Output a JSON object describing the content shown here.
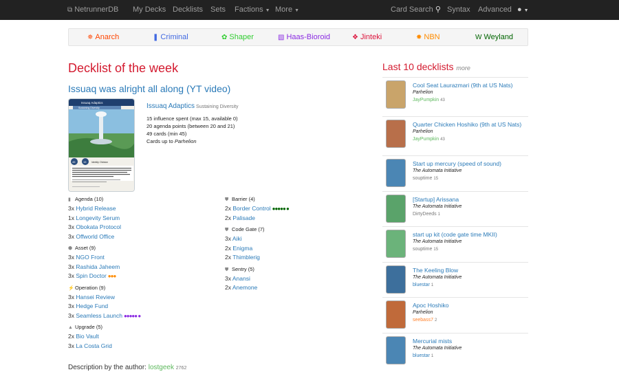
{
  "nav": {
    "brand": "NetrunnerDB",
    "links": [
      "My Decks",
      "Decklists",
      "Sets"
    ],
    "factions_label": "Factions",
    "more_label": "More",
    "card_search": "Card Search",
    "syntax": "Syntax",
    "advanced": "Advanced"
  },
  "factions": [
    {
      "label": "Anarch",
      "color": "#ff4500",
      "icon": "anarch-icon"
    },
    {
      "label": "Criminal",
      "color": "#4169e1",
      "icon": "criminal-icon"
    },
    {
      "label": "Shaper",
      "color": "#32cd32",
      "icon": "shaper-icon"
    },
    {
      "label": "Haas-Bioroid",
      "color": "#8a2be2",
      "icon": "haas-bioroid-icon"
    },
    {
      "label": "Jinteki",
      "color": "#dc143c",
      "icon": "jinteki-icon"
    },
    {
      "label": "NBN",
      "color": "#ff8c00",
      "icon": "nbn-icon"
    },
    {
      "label": "Weyland",
      "color": "#006400",
      "icon": "weyland-icon"
    }
  ],
  "main": {
    "heading": "Decklist of the week",
    "deck_name": "Issuaq was alright all along (YT video)",
    "identity": "Issuaq Adaptics",
    "identity_sub": "Sustaining Diversity",
    "stats": [
      "15 influence spent (max 15, available 0)",
      "20 agenda points (between 20 and 21)",
      "49 cards (min 45)"
    ],
    "cards_up_to_prefix": "Cards up to",
    "cards_up_to_set": "Parhelion",
    "card_image_text": {
      "title": "Issuaq Adaptics",
      "subtitle": "Sustaining Diversity",
      "stat_left": "45",
      "stat_right": "15",
      "type": "Identity: Division",
      "text": "Whenever you score an agenda that you did not install or advance this turn, place 1 power counter on this identity. You get 1 additional agenda point for each hosted power counter.",
      "flavor": "Bringing Mother Nature up to speed."
    }
  },
  "deck": {
    "left": [
      {
        "title": "Agenda (10)",
        "icon": "agenda-icon",
        "cards": [
          [
            "3x",
            "Hybrid Release",
            ""
          ],
          [
            "1x",
            "Longevity Serum",
            ""
          ],
          [
            "3x",
            "Obokata Protocol",
            ""
          ],
          [
            "3x",
            "Offworld Office",
            ""
          ]
        ]
      },
      {
        "title": "Asset (9)",
        "icon": "asset-icon",
        "cards": [
          [
            "3x",
            "NGO Front",
            ""
          ],
          [
            "3x",
            "Rashida Jaheem",
            ""
          ],
          [
            "3x",
            "Spin Doctor",
            "●●●"
          ]
        ]
      },
      {
        "title": "Operation (9)",
        "icon": "operation-icon",
        "cards": [
          [
            "3x",
            "Hansei Review",
            ""
          ],
          [
            "3x",
            "Hedge Fund",
            ""
          ],
          [
            "3x",
            "Seamless Launch",
            "●●●●● ●"
          ]
        ]
      },
      {
        "title": "Upgrade (5)",
        "icon": "upgrade-icon",
        "cards": [
          [
            "2x",
            "Bio Vault",
            ""
          ],
          [
            "3x",
            "La Costa Grid",
            ""
          ]
        ]
      }
    ],
    "right": [
      {
        "title": "Barrier (4)",
        "icon": "ice-icon",
        "cards": [
          [
            "2x",
            "Border Control",
            "●●●●● ●"
          ],
          [
            "2x",
            "Palisade",
            ""
          ]
        ]
      },
      {
        "title": "Code Gate (7)",
        "icon": "ice-icon",
        "cards": [
          [
            "3x",
            "Aiki",
            ""
          ],
          [
            "2x",
            "Enigma",
            ""
          ],
          [
            "2x",
            "Thimblerig",
            ""
          ]
        ]
      },
      {
        "title": "Sentry (5)",
        "icon": "ice-icon",
        "cards": [
          [
            "3x",
            "Anansi",
            ""
          ],
          [
            "2x",
            "Anemone",
            ""
          ]
        ]
      }
    ],
    "influence_colors": {
      "Spin Doctor": "#ff8c00",
      "Seamless Launch": "#8a2be2",
      "Border Control": "#006400"
    }
  },
  "description": {
    "prefix": "Description by the author:",
    "author": "lostgeek",
    "reputation": "2762"
  },
  "sidebar": {
    "heading": "Last 10 decklists",
    "more": "more",
    "items": [
      {
        "title": "Cool Seat Laurazmari (9th at US Nats)",
        "format": "Parhelion",
        "user": "JayPumpkin",
        "rep": "43",
        "user_color": "#5cb85c",
        "thumb": "#c9a46a"
      },
      {
        "title": "Quarter Chicken Hoshiko (9th at US Nats)",
        "format": "Parhelion",
        "user": "JayPumpkin",
        "rep": "43",
        "user_color": "#5cb85c",
        "thumb": "#b86f4a"
      },
      {
        "title": "Start up mercury (speed of sound)",
        "format": "The Automata Initiative",
        "user": "souptime",
        "rep": "15",
        "user_color": "#777777",
        "thumb": "#4b86b4"
      },
      {
        "title": "[Startup] Arissana",
        "format": "The Automata Initiative",
        "user": "DirtyDeeds",
        "rep": "1",
        "user_color": "#777777",
        "thumb": "#5aa36a"
      },
      {
        "title": "start up kit (code gate time MKII)",
        "format": "The Automata Initiative",
        "user": "souptime",
        "rep": "15",
        "user_color": "#777777",
        "thumb": "#6bb37a"
      },
      {
        "title": "The Keeling Blow",
        "format": "The Automata Initiative",
        "user": "bluestar",
        "rep": "1",
        "user_color": "#2a7ab8",
        "thumb": "#3d6f9c"
      },
      {
        "title": "Apoc Hoshiko",
        "format": "Parhelion",
        "user": "seebass7",
        "rep": "2",
        "user_color": "#ff7f27",
        "thumb": "#c06a3a"
      },
      {
        "title": "Mercurial mists",
        "format": "The Automata Initiative",
        "user": "bluestar",
        "rep": "1",
        "user_color": "#2a7ab8",
        "thumb": "#4b86b4"
      }
    ]
  }
}
